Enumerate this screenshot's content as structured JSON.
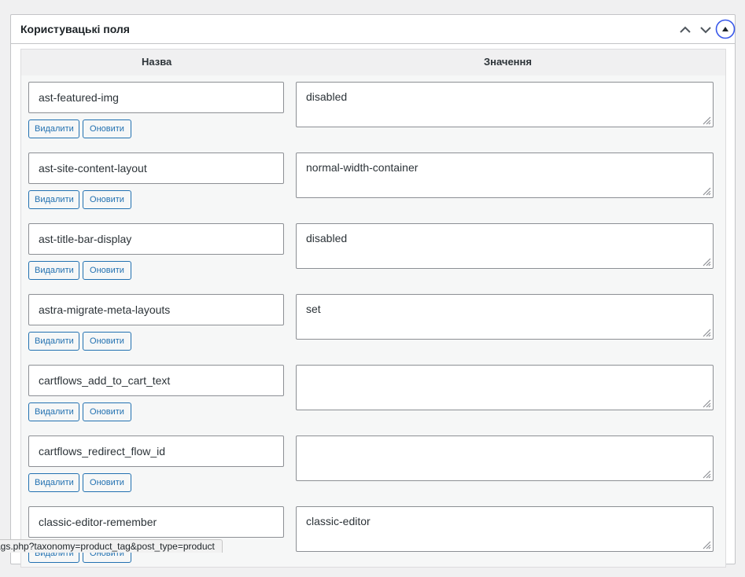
{
  "metabox": {
    "title": "Користувацькі поля",
    "icons": {
      "move_up": "chevron-up-icon",
      "move_down": "chevron-down-icon",
      "toggle": "triangle-up-circle-icon"
    }
  },
  "table": {
    "headers": {
      "name": "Назва",
      "value": "Значення"
    },
    "delete_label": "Видалити",
    "update_label": "Оновити",
    "rows": [
      {
        "key": "ast-featured-img",
        "value": "disabled"
      },
      {
        "key": "ast-site-content-layout",
        "value": "normal-width-container"
      },
      {
        "key": "ast-title-bar-display",
        "value": "disabled"
      },
      {
        "key": "astra-migrate-meta-layouts",
        "value": "set"
      },
      {
        "key": "cartflows_add_to_cart_text",
        "value": ""
      },
      {
        "key": "cartflows_redirect_flow_id",
        "value": ""
      },
      {
        "key": "classic-editor-remember",
        "value": "classic-editor"
      }
    ]
  },
  "status_bar": {
    "url": "ags.php?taxonomy=product_tag&post_type=product"
  },
  "colors": {
    "accent": "#2271b1",
    "border": "#8c8f94",
    "background": "#f0f0f1"
  }
}
